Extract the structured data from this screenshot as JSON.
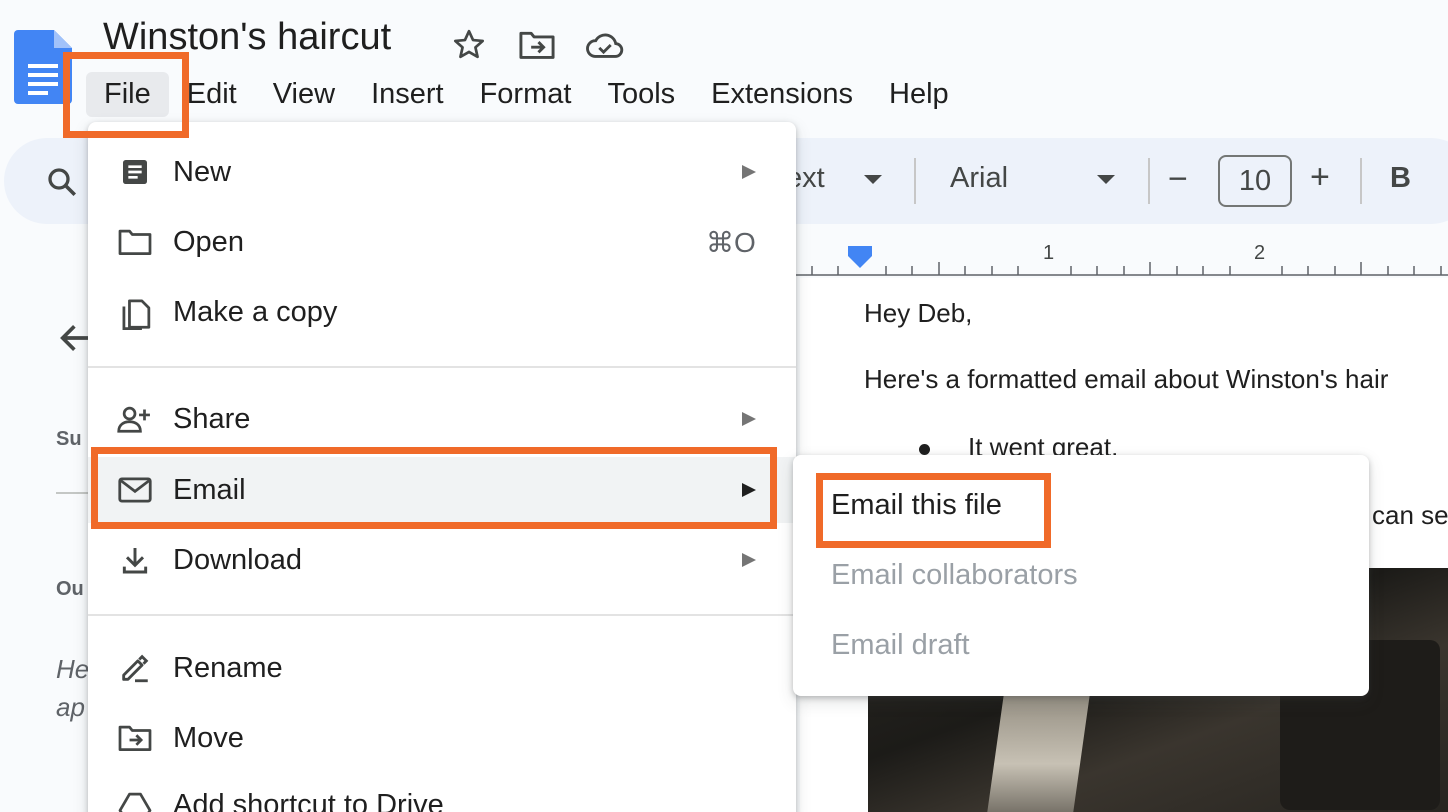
{
  "document": {
    "title": "Winston's haircut"
  },
  "menubar": {
    "items": [
      "File",
      "Edit",
      "View",
      "Insert",
      "Format",
      "Tools",
      "Extensions",
      "Help"
    ]
  },
  "toolbar": {
    "style_partial": "ext",
    "font": "Arial",
    "font_size": "10",
    "minus": "−",
    "plus": "+",
    "bold": "B"
  },
  "ruler": {
    "labels": [
      "1",
      "2"
    ]
  },
  "side_panel": {
    "label_1": "Su",
    "label_2": "Ou",
    "italic_1": "He",
    "italic_2": "ap"
  },
  "doc_body": {
    "greeting": "Hey Deb,",
    "line_1": "Here's a formatted email about Winston's hair",
    "bullet_1": "It went great.",
    "line_partial": "can se"
  },
  "file_menu": {
    "items": [
      {
        "label": "New",
        "icon": "document-icon",
        "has_submenu": true
      },
      {
        "label": "Open",
        "icon": "folder-icon",
        "shortcut": "⌘O"
      },
      {
        "label": "Make a copy",
        "icon": "copy-icon"
      },
      {
        "label": "Share",
        "icon": "share-person-icon",
        "has_submenu": true
      },
      {
        "label": "Email",
        "icon": "mail-icon",
        "has_submenu": true
      },
      {
        "label": "Download",
        "icon": "download-icon",
        "has_submenu": true
      },
      {
        "label": "Rename",
        "icon": "rename-pen-icon"
      },
      {
        "label": "Move",
        "icon": "move-folder-icon"
      },
      {
        "label": "Add shortcut to Drive",
        "icon": "drive-shortcut-icon"
      }
    ]
  },
  "email_submenu": {
    "items": [
      {
        "label": "Email this file",
        "enabled": true
      },
      {
        "label": "Email collaborators",
        "enabled": false
      },
      {
        "label": "Email draft",
        "enabled": false
      }
    ]
  },
  "colors": {
    "highlight": "#f06a29",
    "docs_blue": "#4285f4",
    "toolbar_bg": "#edf2fa"
  }
}
